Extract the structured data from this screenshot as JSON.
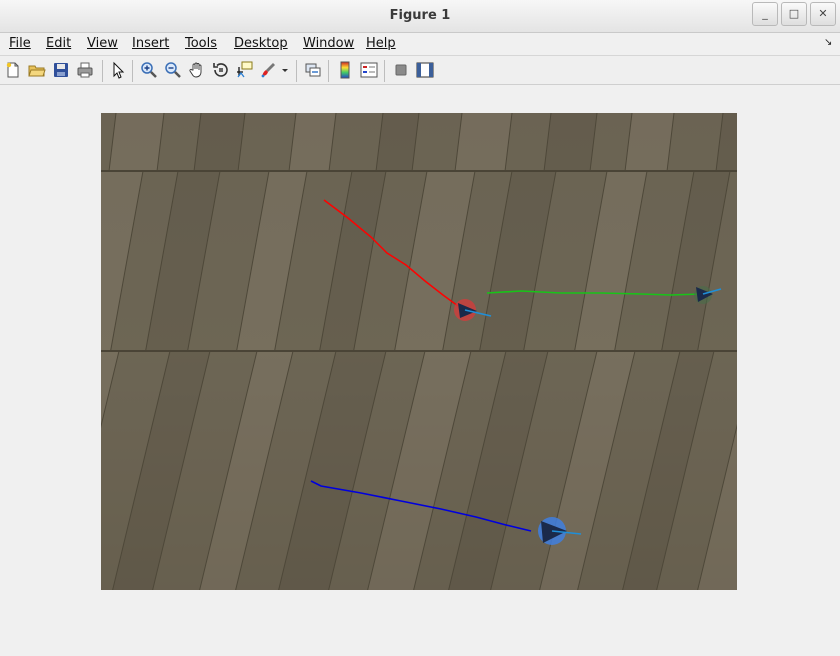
{
  "window": {
    "title": "Figure 1"
  },
  "window_controls": {
    "minimize": "_",
    "maximize": "□",
    "close": "✕"
  },
  "menubar": {
    "items": [
      {
        "id": "file",
        "label": "File"
      },
      {
        "id": "edit",
        "label": "Edit"
      },
      {
        "id": "view",
        "label": "View"
      },
      {
        "id": "insert",
        "label": "Insert"
      },
      {
        "id": "tools",
        "label": "Tools"
      },
      {
        "id": "desktop",
        "label": "Desktop"
      },
      {
        "id": "window",
        "label": "Window"
      },
      {
        "id": "help",
        "label": "Help"
      }
    ],
    "dock_glyph": "↘"
  },
  "toolbar": {
    "icons": [
      "new-figure-icon",
      "open-file-icon",
      "save-icon",
      "print-icon",
      "edit-plot-arrow-icon",
      "zoom-in-icon",
      "zoom-out-icon",
      "pan-hand-icon",
      "rotate-3d-icon",
      "data-cursor-icon",
      "brush-icon",
      "brush-dropdown-icon",
      "link-plot-icon",
      "insert-colorbar-icon",
      "insert-legend-icon",
      "hide-plot-tools-icon",
      "show-plot-tools-icon"
    ]
  },
  "scene": {
    "floor_colors": {
      "dark": "#5e5748",
      "mid": "#6b6453",
      "light": "#7d7564"
    },
    "tracks": [
      {
        "name": "red",
        "color": "#ff0000",
        "marker": "#d93a3a"
      },
      {
        "name": "green",
        "color": "#18c418",
        "marker": "#4a6e4a"
      },
      {
        "name": "blue",
        "color": "#0000dd",
        "marker": "#3f7fe0"
      }
    ],
    "heading_color": "#1f8fd8"
  }
}
